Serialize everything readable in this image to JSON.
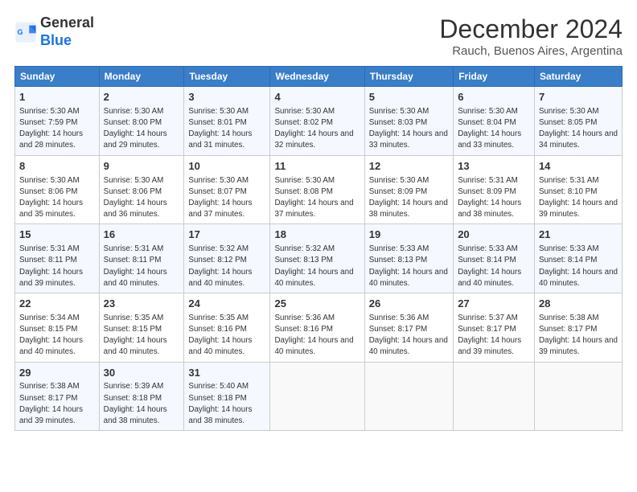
{
  "logo": {
    "line1": "General",
    "line2": "Blue"
  },
  "title": "December 2024",
  "subtitle": "Rauch, Buenos Aires, Argentina",
  "columns": [
    "Sunday",
    "Monday",
    "Tuesday",
    "Wednesday",
    "Thursday",
    "Friday",
    "Saturday"
  ],
  "weeks": [
    [
      {
        "day": "1",
        "sunrise": "5:30 AM",
        "sunset": "7:59 PM",
        "daylight": "14 hours and 28 minutes."
      },
      {
        "day": "2",
        "sunrise": "5:30 AM",
        "sunset": "8:00 PM",
        "daylight": "14 hours and 29 minutes."
      },
      {
        "day": "3",
        "sunrise": "5:30 AM",
        "sunset": "8:01 PM",
        "daylight": "14 hours and 31 minutes."
      },
      {
        "day": "4",
        "sunrise": "5:30 AM",
        "sunset": "8:02 PM",
        "daylight": "14 hours and 32 minutes."
      },
      {
        "day": "5",
        "sunrise": "5:30 AM",
        "sunset": "8:03 PM",
        "daylight": "14 hours and 33 minutes."
      },
      {
        "day": "6",
        "sunrise": "5:30 AM",
        "sunset": "8:04 PM",
        "daylight": "14 hours and 33 minutes."
      },
      {
        "day": "7",
        "sunrise": "5:30 AM",
        "sunset": "8:05 PM",
        "daylight": "14 hours and 34 minutes."
      }
    ],
    [
      {
        "day": "8",
        "sunrise": "5:30 AM",
        "sunset": "8:06 PM",
        "daylight": "14 hours and 35 minutes."
      },
      {
        "day": "9",
        "sunrise": "5:30 AM",
        "sunset": "8:06 PM",
        "daylight": "14 hours and 36 minutes."
      },
      {
        "day": "10",
        "sunrise": "5:30 AM",
        "sunset": "8:07 PM",
        "daylight": "14 hours and 37 minutes."
      },
      {
        "day": "11",
        "sunrise": "5:30 AM",
        "sunset": "8:08 PM",
        "daylight": "14 hours and 37 minutes."
      },
      {
        "day": "12",
        "sunrise": "5:30 AM",
        "sunset": "8:09 PM",
        "daylight": "14 hours and 38 minutes."
      },
      {
        "day": "13",
        "sunrise": "5:31 AM",
        "sunset": "8:09 PM",
        "daylight": "14 hours and 38 minutes."
      },
      {
        "day": "14",
        "sunrise": "5:31 AM",
        "sunset": "8:10 PM",
        "daylight": "14 hours and 39 minutes."
      }
    ],
    [
      {
        "day": "15",
        "sunrise": "5:31 AM",
        "sunset": "8:11 PM",
        "daylight": "14 hours and 39 minutes."
      },
      {
        "day": "16",
        "sunrise": "5:31 AM",
        "sunset": "8:11 PM",
        "daylight": "14 hours and 40 minutes."
      },
      {
        "day": "17",
        "sunrise": "5:32 AM",
        "sunset": "8:12 PM",
        "daylight": "14 hours and 40 minutes."
      },
      {
        "day": "18",
        "sunrise": "5:32 AM",
        "sunset": "8:13 PM",
        "daylight": "14 hours and 40 minutes."
      },
      {
        "day": "19",
        "sunrise": "5:33 AM",
        "sunset": "8:13 PM",
        "daylight": "14 hours and 40 minutes."
      },
      {
        "day": "20",
        "sunrise": "5:33 AM",
        "sunset": "8:14 PM",
        "daylight": "14 hours and 40 minutes."
      },
      {
        "day": "21",
        "sunrise": "5:33 AM",
        "sunset": "8:14 PM",
        "daylight": "14 hours and 40 minutes."
      }
    ],
    [
      {
        "day": "22",
        "sunrise": "5:34 AM",
        "sunset": "8:15 PM",
        "daylight": "14 hours and 40 minutes."
      },
      {
        "day": "23",
        "sunrise": "5:35 AM",
        "sunset": "8:15 PM",
        "daylight": "14 hours and 40 minutes."
      },
      {
        "day": "24",
        "sunrise": "5:35 AM",
        "sunset": "8:16 PM",
        "daylight": "14 hours and 40 minutes."
      },
      {
        "day": "25",
        "sunrise": "5:36 AM",
        "sunset": "8:16 PM",
        "daylight": "14 hours and 40 minutes."
      },
      {
        "day": "26",
        "sunrise": "5:36 AM",
        "sunset": "8:17 PM",
        "daylight": "14 hours and 40 minutes."
      },
      {
        "day": "27",
        "sunrise": "5:37 AM",
        "sunset": "8:17 PM",
        "daylight": "14 hours and 39 minutes."
      },
      {
        "day": "28",
        "sunrise": "5:38 AM",
        "sunset": "8:17 PM",
        "daylight": "14 hours and 39 minutes."
      }
    ],
    [
      {
        "day": "29",
        "sunrise": "5:38 AM",
        "sunset": "8:17 PM",
        "daylight": "14 hours and 39 minutes."
      },
      {
        "day": "30",
        "sunrise": "5:39 AM",
        "sunset": "8:18 PM",
        "daylight": "14 hours and 38 minutes."
      },
      {
        "day": "31",
        "sunrise": "5:40 AM",
        "sunset": "8:18 PM",
        "daylight": "14 hours and 38 minutes."
      },
      null,
      null,
      null,
      null
    ]
  ]
}
